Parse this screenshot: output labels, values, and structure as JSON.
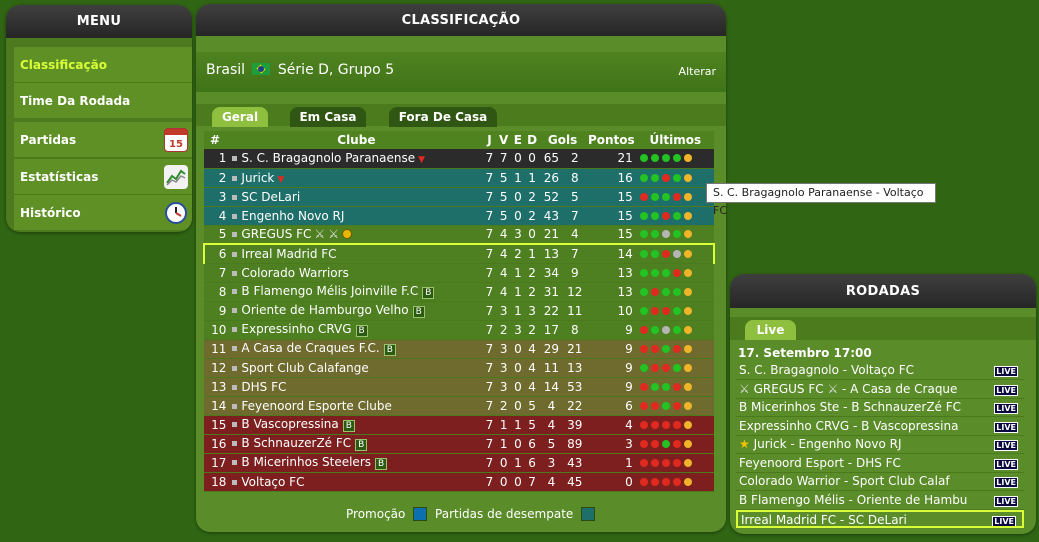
{
  "menu": {
    "title": "MENU",
    "items": [
      {
        "label": "Classificação",
        "active": true
      },
      {
        "label": "Time Da Rodada"
      },
      {
        "label": "Partidas",
        "icon": "calendar-icon",
        "icon_text": "15"
      },
      {
        "label": "Estatísticas",
        "icon": "chart-icon"
      },
      {
        "label": "Histórico",
        "icon": "clock-icon"
      }
    ]
  },
  "classif": {
    "title": "CLASSIFICAÇÃO",
    "country": "Brasil",
    "league": "Série D, Grupo 5",
    "alterar": "Alterar",
    "tabs": [
      "Geral",
      "Em Casa",
      "Fora De Casa"
    ],
    "headers": [
      "#",
      "Clube",
      "J",
      "V",
      "E",
      "D",
      "Gols",
      "Pontos",
      "Últimos"
    ],
    "legend": {
      "promocao": "Promoção",
      "desempate": "Partidas de desempate"
    },
    "colors": {
      "black": "#2b2b2b",
      "teal": "#1e6f6a",
      "olive": "#6f6a2d",
      "red": "#7d1f1f",
      "green": "#4e7f20",
      "promo": "#0c6fae",
      "desempate": "#1e6f6a"
    }
  },
  "standings": [
    {
      "pos": "1",
      "club": "S. C. Bragagnolo Paranaense",
      "j": "7",
      "v": "7",
      "e": "0",
      "d": "0",
      "gf": "65",
      "ga": "2",
      "pts": "21",
      "bg": "black",
      "extra": "down",
      "form": [
        "g",
        "g",
        "g",
        "g",
        "y"
      ]
    },
    {
      "pos": "2",
      "club": "Jurick",
      "j": "7",
      "v": "5",
      "e": "1",
      "d": "1",
      "gf": "26",
      "ga": "8",
      "pts": "16",
      "bg": "teal",
      "extra": "down",
      "form": [
        "g",
        "g",
        "r",
        "g",
        "y"
      ]
    },
    {
      "pos": "3",
      "club": "SC DeLari",
      "j": "7",
      "v": "5",
      "e": "0",
      "d": "2",
      "gf": "52",
      "ga": "5",
      "pts": "15",
      "bg": "teal",
      "form": [
        "r",
        "g",
        "g",
        "r",
        "y"
      ]
    },
    {
      "pos": "4",
      "club": "Engenho Novo RJ",
      "j": "7",
      "v": "5",
      "e": "0",
      "d": "2",
      "gf": "43",
      "ga": "7",
      "pts": "15",
      "bg": "teal",
      "form": [
        "g",
        "g",
        "r",
        "g",
        "y"
      ]
    },
    {
      "pos": "5",
      "club": "GREGUS FC",
      "j": "7",
      "v": "4",
      "e": "3",
      "d": "0",
      "gf": "21",
      "ga": "4",
      "pts": "15",
      "bg": "green",
      "extra": "swords",
      "form": [
        "g",
        "g",
        "gray",
        "g",
        "y"
      ]
    },
    {
      "pos": "6",
      "club": "Irreal Madrid FC",
      "j": "7",
      "v": "4",
      "e": "2",
      "d": "1",
      "gf": "13",
      "ga": "7",
      "pts": "14",
      "bg": "green",
      "hl": true,
      "form": [
        "g",
        "g",
        "r",
        "gray",
        "y"
      ]
    },
    {
      "pos": "7",
      "club": "Colorado Warriors",
      "j": "7",
      "v": "4",
      "e": "1",
      "d": "2",
      "gf": "34",
      "ga": "9",
      "pts": "13",
      "bg": "green",
      "form": [
        "g",
        "g",
        "g",
        "r",
        "y"
      ]
    },
    {
      "pos": "8",
      "club": "B Flamengo Mélis Joinville F.C",
      "j": "7",
      "v": "4",
      "e": "1",
      "d": "2",
      "gf": "31",
      "ga": "12",
      "pts": "13",
      "bg": "green",
      "badge": "B",
      "form": [
        "g",
        "r",
        "g",
        "g",
        "y"
      ]
    },
    {
      "pos": "9",
      "club": "Oriente de Hamburgo Velho",
      "j": "7",
      "v": "3",
      "e": "1",
      "d": "3",
      "gf": "22",
      "ga": "11",
      "pts": "10",
      "bg": "green",
      "badge": "B",
      "form": [
        "g",
        "r",
        "r",
        "g",
        "y"
      ]
    },
    {
      "pos": "10",
      "club": "Expressinho CRVG",
      "j": "7",
      "v": "2",
      "e": "3",
      "d": "2",
      "gf": "17",
      "ga": "8",
      "pts": "9",
      "bg": "green",
      "badge": "B",
      "form": [
        "r",
        "g",
        "gray",
        "g",
        "y"
      ]
    },
    {
      "pos": "11",
      "club": "A Casa de Craques F.C.",
      "j": "7",
      "v": "3",
      "e": "0",
      "d": "4",
      "gf": "29",
      "ga": "21",
      "pts": "9",
      "bg": "olive",
      "badge": "B",
      "form": [
        "r",
        "r",
        "g",
        "r",
        "y"
      ]
    },
    {
      "pos": "12",
      "club": "Sport Club Calafange",
      "j": "7",
      "v": "3",
      "e": "0",
      "d": "4",
      "gf": "11",
      "ga": "13",
      "pts": "9",
      "bg": "olive",
      "form": [
        "g",
        "r",
        "r",
        "g",
        "y"
      ]
    },
    {
      "pos": "13",
      "club": "DHS FC",
      "j": "7",
      "v": "3",
      "e": "0",
      "d": "4",
      "gf": "14",
      "ga": "53",
      "pts": "9",
      "bg": "olive",
      "form": [
        "r",
        "g",
        "g",
        "r",
        "y"
      ]
    },
    {
      "pos": "14",
      "club": "Feyenoord Esporte Clube",
      "j": "7",
      "v": "2",
      "e": "0",
      "d": "5",
      "gf": "4",
      "ga": "22",
      "pts": "6",
      "bg": "olive",
      "form": [
        "r",
        "r",
        "g",
        "r",
        "y"
      ]
    },
    {
      "pos": "15",
      "club": "B Vascopressina",
      "j": "7",
      "v": "1",
      "e": "1",
      "d": "5",
      "gf": "4",
      "ga": "39",
      "pts": "4",
      "bg": "red",
      "badge": "B",
      "form": [
        "r",
        "r",
        "r",
        "r",
        "y"
      ]
    },
    {
      "pos": "16",
      "club": "B SchnauzerZé FC",
      "j": "7",
      "v": "1",
      "e": "0",
      "d": "6",
      "gf": "5",
      "ga": "89",
      "pts": "3",
      "bg": "red",
      "badge": "B",
      "form": [
        "r",
        "r",
        "g",
        "r",
        "y"
      ]
    },
    {
      "pos": "17",
      "club": "B Micerinhos Steelers",
      "j": "7",
      "v": "0",
      "e": "1",
      "d": "6",
      "gf": "3",
      "ga": "43",
      "pts": "1",
      "bg": "red",
      "badge": "B",
      "form": [
        "r",
        "r",
        "r",
        "r",
        "y"
      ]
    },
    {
      "pos": "18",
      "club": "Voltaço FC",
      "j": "7",
      "v": "0",
      "e": "0",
      "d": "7",
      "gf": "4",
      "ga": "45",
      "pts": "0",
      "bg": "red",
      "form": [
        "r",
        "r",
        "r",
        "r",
        "y"
      ]
    }
  ],
  "tooltip": "S. C. Bragagnolo Paranaense - Voltaço FC",
  "rodadas": {
    "title": "RODADAS",
    "tab": "Live",
    "date": "17. Setembro 17:00",
    "live_label": "LIVE",
    "matches": [
      {
        "text": "S. C. Bragagnolo - Voltaço FC"
      },
      {
        "text": "GREGUS FC",
        "text2": " - A Casa de Craque",
        "swords": true
      },
      {
        "text": "B Micerinhos Ste - B SchnauzerZé FC"
      },
      {
        "text": "Expressinho CRVG - B Vascopressina"
      },
      {
        "text": "Jurick - Engenho Novo RJ",
        "star": true
      },
      {
        "text": "Feyenoord Esport - DHS FC"
      },
      {
        "text": "Colorado Warrior - Sport Club Calaf"
      },
      {
        "text": "B Flamengo Mélis - Oriente de Hambu"
      },
      {
        "text": "Irreal Madrid FC - SC DeLari",
        "hl": true
      }
    ]
  }
}
